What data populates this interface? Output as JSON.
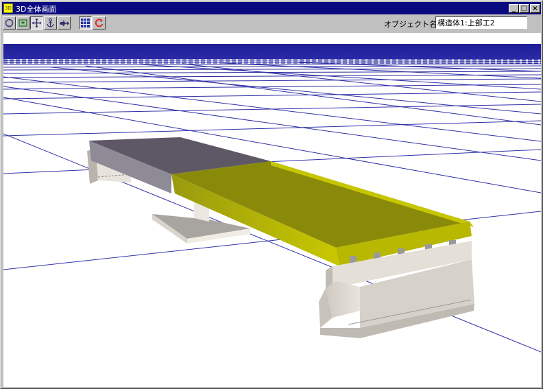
{
  "window": {
    "title": "3D全体画面",
    "app_icon": "3d-app-icon",
    "controls": [
      "minimize",
      "maximize",
      "close"
    ]
  },
  "toolbar": {
    "buttons": [
      {
        "name": "rotate",
        "icon": "rotate-icon"
      },
      {
        "name": "zoom",
        "icon": "zoom-icon"
      },
      {
        "name": "pan",
        "icon": "pan-move-icon"
      },
      {
        "name": "walk",
        "icon": "walk-anchor-icon"
      },
      {
        "name": "fly",
        "icon": "airplane-icon"
      },
      {
        "name": "grid-toggle",
        "icon": "grid-icon"
      },
      {
        "name": "reset-view",
        "icon": "reset-rotate-icon"
      }
    ],
    "object_name_label": "オブジェクト名",
    "object_name_value": "構造体1:上部工2"
  },
  "scene": {
    "sky_color": "#1a1a8c",
    "grid_color": "#2a2aa0",
    "deck_front_color": "#b8b800",
    "deck_back_color": "#6a6470",
    "abutment_color": "#d8d4cc"
  }
}
